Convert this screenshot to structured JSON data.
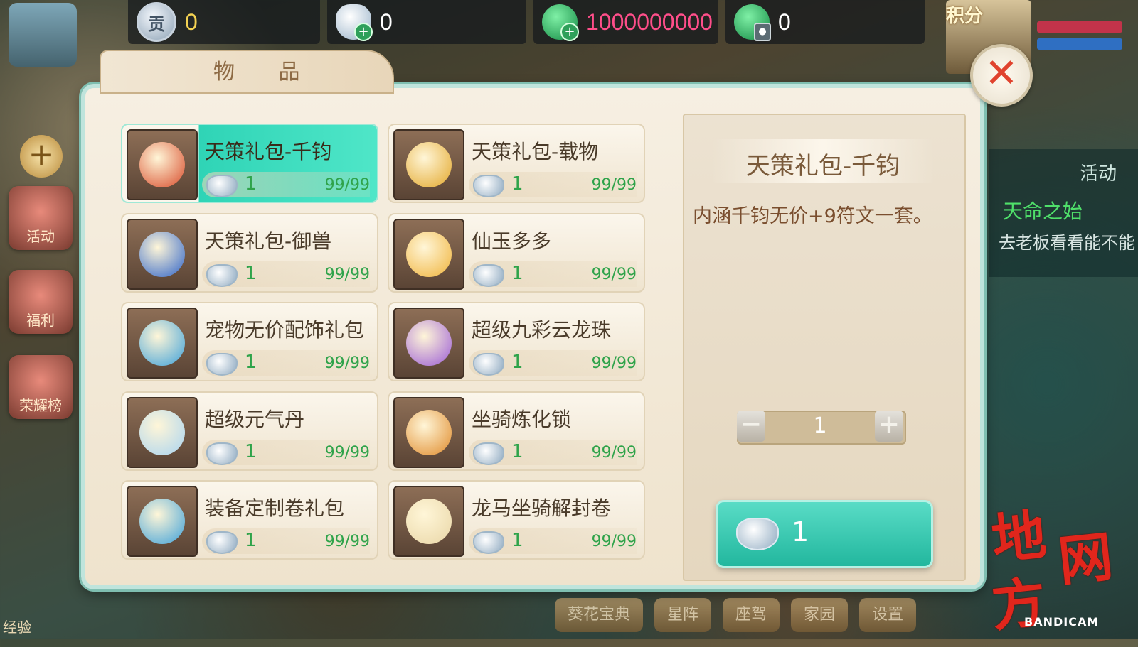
{
  "currencies": [
    {
      "icon": "contribution-coin-icon",
      "badge": "贡",
      "value": "0"
    },
    {
      "icon": "silver-ingot-icon",
      "value": "0"
    },
    {
      "icon": "jade-plus-icon",
      "value": "1000000000"
    },
    {
      "icon": "jade-locked-icon",
      "value": "0"
    }
  ],
  "left_nav": [
    {
      "label": "活动"
    },
    {
      "label": "福利"
    },
    {
      "label": "荣耀榜"
    }
  ],
  "exp_label": "经验",
  "player": {
    "score_label": "积分"
  },
  "right_panel": {
    "tab": "活动",
    "quest_title": "天命之始",
    "quest_text": "去老板看看能不能"
  },
  "bottom_bar": [
    "葵花宝典",
    "星阵",
    "座驾",
    "家园",
    "设置"
  ],
  "panel": {
    "title": "物 品"
  },
  "items": [
    {
      "name": "天策礼包-千钧",
      "price": "1",
      "stock": "99/99",
      "icon": "scroll-red-gold-icon",
      "color": "#d84b2a"
    },
    {
      "name": "天策礼包-载物",
      "price": "1",
      "stock": "99/99",
      "icon": "scroll-gold-red-icon",
      "color": "#e3a72a"
    },
    {
      "name": "天策礼包-御兽",
      "price": "1",
      "stock": "99/99",
      "icon": "scroll-blue-red-icon",
      "color": "#2e63c9"
    },
    {
      "name": "仙玉多多",
      "price": "1",
      "stock": "99/99",
      "icon": "treasure-bag-icon",
      "color": "#f0b33a"
    },
    {
      "name": "宠物无价配饰礼包",
      "price": "1",
      "stock": "99/99",
      "icon": "gift-bag-blue-icon",
      "color": "#3da0d9"
    },
    {
      "name": "超级九彩云龙珠",
      "price": "1",
      "stock": "99/99",
      "icon": "rainbow-pearl-icon",
      "color": "#9b5cd6"
    },
    {
      "name": "超级元气丹",
      "price": "1",
      "stock": "99/99",
      "icon": "crystal-orb-icon",
      "color": "#a9d3f0"
    },
    {
      "name": "坐骑炼化锁",
      "price": "1",
      "stock": "99/99",
      "icon": "lion-head-icon",
      "color": "#e08a2a"
    },
    {
      "name": "装备定制卷礼包",
      "price": "1",
      "stock": "99/99",
      "icon": "gift-bag-blue-icon",
      "color": "#3da0d9"
    },
    {
      "name": "龙马坐骑解封卷",
      "price": "1",
      "stock": "99/99",
      "icon": "dragon-horse-icon",
      "color": "#e9d6a6"
    }
  ],
  "detail": {
    "title": "天策礼包-千钧",
    "description": "内涵千钧无价+9符文一套。",
    "quantity": "1",
    "buy_price": "1"
  },
  "watermark": {
    "chars": [
      "地",
      "方",
      "网"
    ],
    "recorder": "BANDICAM"
  }
}
